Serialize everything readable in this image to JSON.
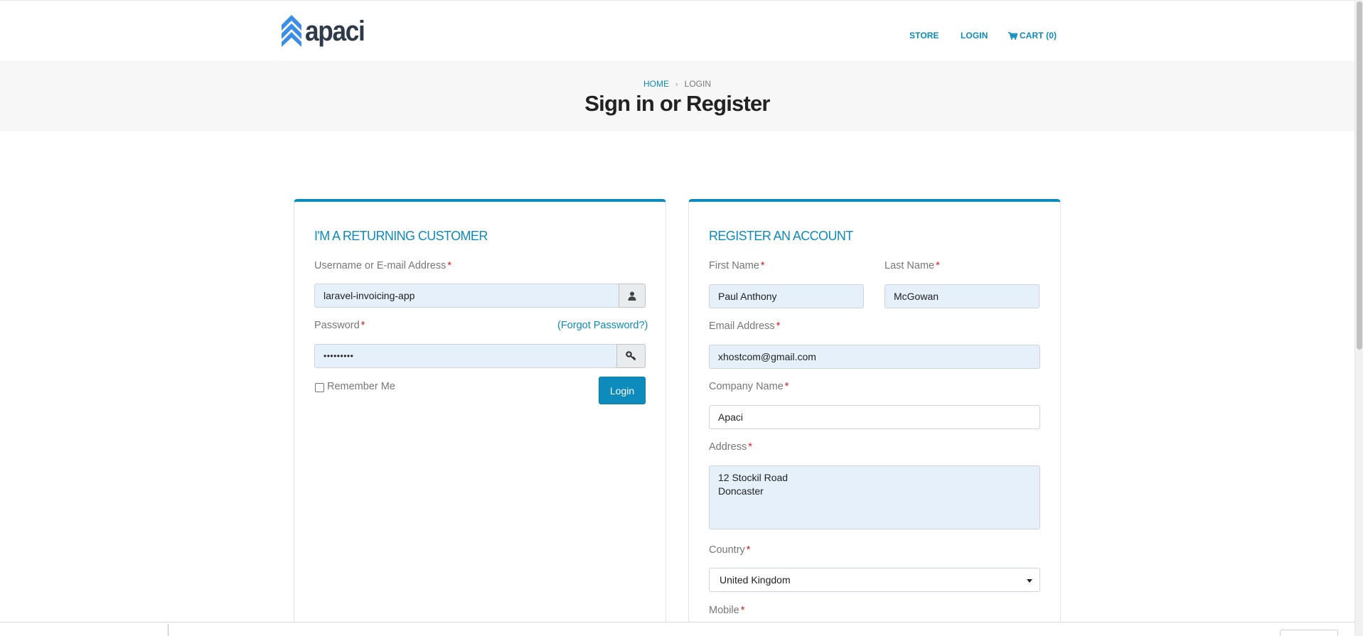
{
  "brand": {
    "name": "apaci",
    "color": "#3a8ee6"
  },
  "nav": {
    "store": "STORE",
    "login": "LOGIN",
    "cart": "CART (0)",
    "cart_icon": "shopping-cart-icon"
  },
  "breadcrumb": {
    "home": "HOME",
    "current": "LOGIN"
  },
  "page_title": "Sign in or Register",
  "accent_color": "#0d8bbd",
  "login_panel": {
    "title": "I'M A RETURNING CUSTOMER",
    "username_label": "Username or E-mail Address",
    "username_value": "laravel-invoicing-app",
    "username_icon": "user-icon",
    "password_label": "Password",
    "password_value": "•••••••••",
    "password_icon": "key-icon",
    "forgot_password": "(Forgot Password?)",
    "remember_me": "Remember Me",
    "login_button": "Login"
  },
  "register_panel": {
    "title": "REGISTER AN ACCOUNT",
    "first_name_label": "First Name",
    "first_name_value": "Paul Anthony",
    "last_name_label": "Last Name",
    "last_name_value": "McGowan",
    "email_label": "Email Address",
    "email_value": "xhostcom@gmail.com",
    "company_label": "Company Name",
    "company_value": "Apaci",
    "address_label": "Address",
    "address_value": "12 Stockil Road\nDoncaster",
    "country_label": "Country",
    "country_value": "United Kingdom",
    "mobile_label": "Mobile"
  },
  "required_marker": "*"
}
